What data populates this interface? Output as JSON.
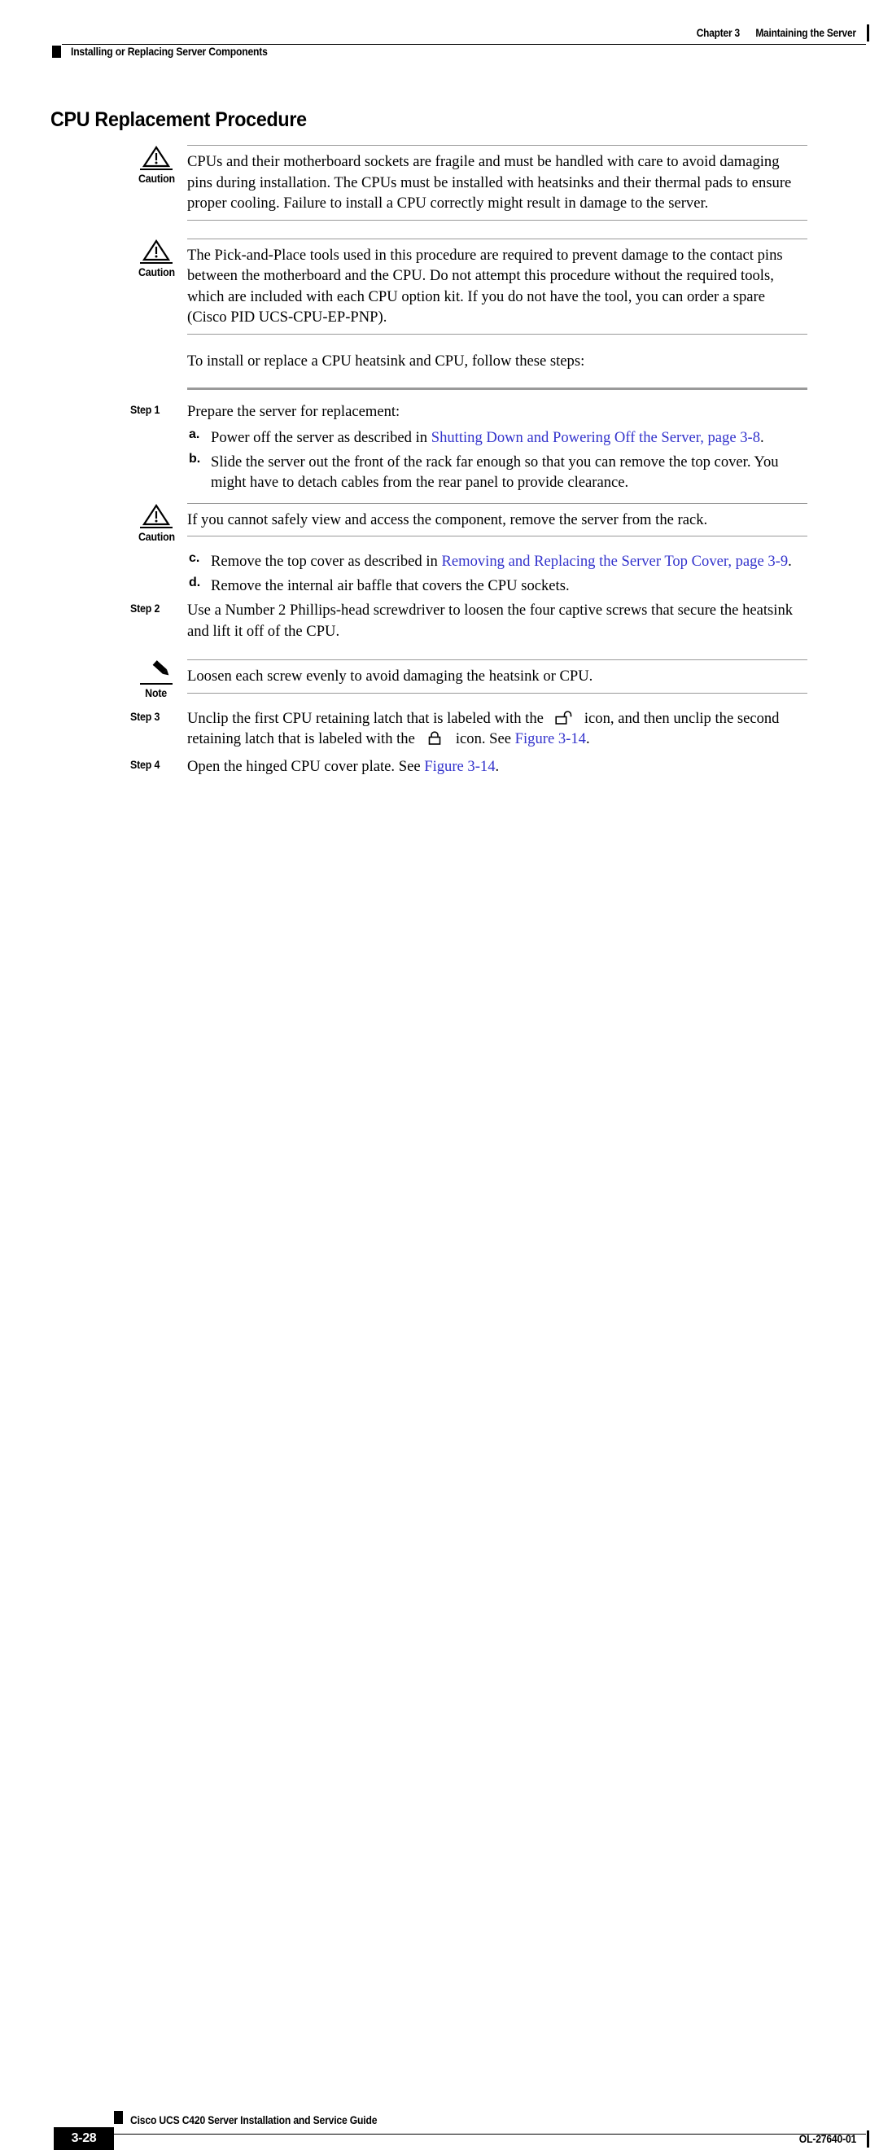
{
  "header": {
    "chapter_number": "Chapter 3",
    "chapter_title": "Maintaining the Server",
    "section_title": "Installing or Replacing Server Components"
  },
  "page_title": "CPU Replacement Procedure",
  "admonitions": {
    "caution_label": "Caution",
    "note_label": "Note",
    "caution_1": "CPUs and their motherboard sockets are fragile and must be handled with care to avoid damaging pins during installation. The CPUs must be installed with heatsinks and their thermal pads to ensure proper cooling. Failure to install a CPU correctly might result in damage to the server.",
    "caution_2": "The Pick-and-Place tools used in this procedure are required to prevent damage to the contact pins between the motherboard and the CPU. Do not attempt this procedure without the required tools, which are included with each CPU option kit. If you do not have the tool, you can order a spare (Cisco PID UCS-CPU-EP-PNP).",
    "caution_3": "If you cannot safely view and access the component, remove the server from the rack.",
    "note_1": "Loosen each screw evenly to avoid damaging the heatsink or CPU."
  },
  "intro_paragraph": "To install or replace a CPU heatsink and CPU, follow these steps:",
  "steps": {
    "step1_label": "Step 1",
    "step1_text": "Prepare the server for replacement:",
    "sub_a_marker": "a.",
    "sub_a_text_before": "Power off the server as described in ",
    "sub_a_link": "Shutting Down and Powering Off the Server, page 3-8",
    "sub_a_text_after": ".",
    "sub_b_marker": "b.",
    "sub_b_text": "Slide the server out the front of the rack far enough so that you can remove the top cover. You might have to detach cables from the rear panel to provide clearance.",
    "sub_c_marker": "c.",
    "sub_c_text_before": "Remove the top cover as described in ",
    "sub_c_link": "Removing and Replacing the Server Top Cover, page 3-9",
    "sub_c_text_after": ".",
    "sub_d_marker": "d.",
    "sub_d_text": "Remove the internal air baffle that covers the CPU sockets.",
    "step2_label": "Step 2",
    "step2_text": "Use a Number 2 Phillips-head screwdriver to loosen the four captive screws that secure the heatsink and lift it off of the CPU.",
    "step3_label": "Step 3",
    "step3_text_1": "Unclip the first CPU retaining latch that is labeled with the",
    "step3_text_2": "icon, and then unclip the second retaining latch that is labeled with the",
    "step3_text_3": "icon. See ",
    "step3_link": "Figure 3-14",
    "step3_text_4": ".",
    "step4_label": "Step 4",
    "step4_text_1": "Open the hinged CPU cover plate. See ",
    "step4_link": "Figure 3-14",
    "step4_text_2": "."
  },
  "footer": {
    "page_number": "3-28",
    "guide_title": "Cisco UCS C420 Server Installation and Service Guide",
    "doc_number": "OL-27640-01"
  },
  "colors": {
    "link": "#3333CC",
    "rule": "#999999",
    "steps_rule": "#9A9A9A",
    "text": "#000000"
  },
  "icons": {
    "caution": "warning-triangle-icon",
    "note": "pencil-icon",
    "unlock": "unlock-icon",
    "lock": "lock-icon"
  }
}
